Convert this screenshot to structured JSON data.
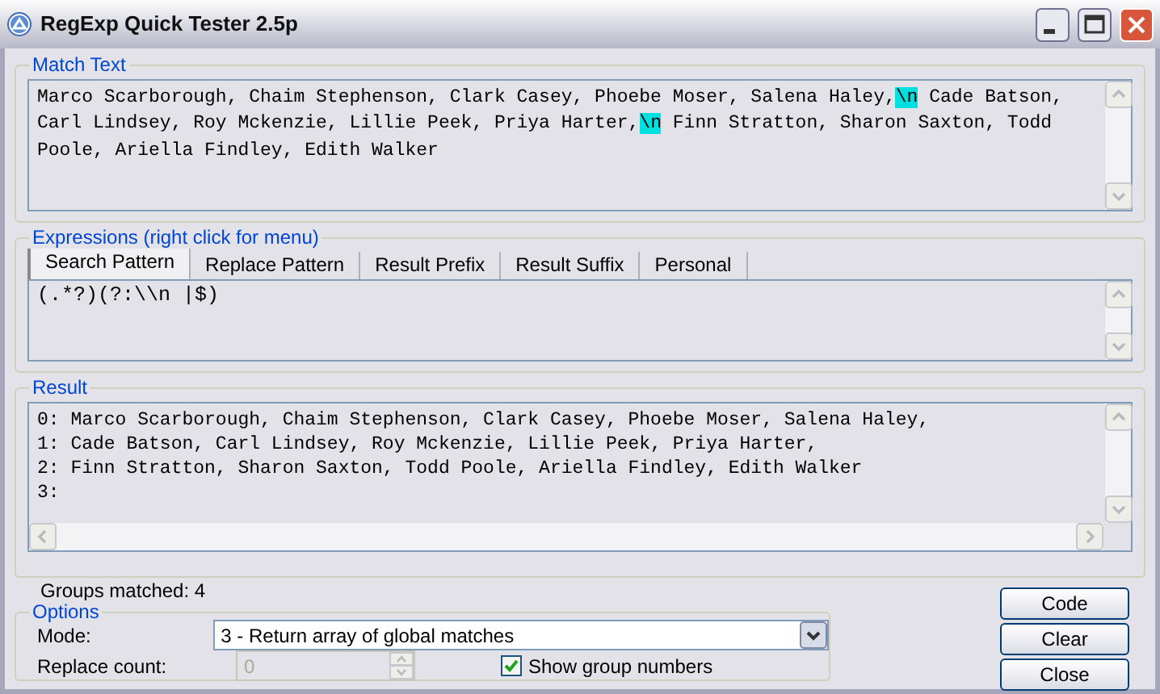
{
  "window": {
    "title": "RegExp Quick Tester 2.5p"
  },
  "match_text": {
    "label": "Match Text",
    "segments": [
      {
        "text": "Marco Scarborough, Chaim Stephenson, Clark Casey, Phoebe Moser, Salena Haley,",
        "highlighted": false
      },
      {
        "text": "\\n",
        "highlighted": true
      },
      {
        "text": " Cade Batson, Carl Lindsey, Roy Mckenzie, Lillie Peek, Priya Harter,",
        "highlighted": false
      },
      {
        "text": "\\n",
        "highlighted": true
      },
      {
        "text": " Finn Stratton, Sharon Saxton, Todd Poole, Ariella Findley, Edith Walker",
        "highlighted": false
      }
    ]
  },
  "expressions": {
    "label": "Expressions (right click for menu)",
    "tabs": [
      {
        "label": "Search Pattern",
        "selected": true
      },
      {
        "label": "Replace Pattern",
        "selected": false
      },
      {
        "label": "Result Prefix",
        "selected": false
      },
      {
        "label": "Result Suffix",
        "selected": false
      },
      {
        "label": "Personal",
        "selected": false
      }
    ],
    "pattern": "(.*?)(?:\\\\n |$)"
  },
  "result": {
    "label": "Result",
    "lines": [
      "0: Marco Scarborough, Chaim Stephenson, Clark Casey, Phoebe Moser, Salena Haley,",
      "1: Cade Batson, Carl Lindsey, Roy Mckenzie, Lillie Peek, Priya Harter,",
      "2: Finn Stratton, Sharon Saxton, Todd Poole, Ariella Findley, Edith Walker",
      "3:"
    ]
  },
  "groups_matched": "Groups matched: 4",
  "options": {
    "label": "Options",
    "mode_label": "Mode:",
    "mode_value": "3 - Return array of global matches",
    "replace_count_label": "Replace count:",
    "replace_count_value": "0",
    "replace_count_disabled": true,
    "show_group_numbers": {
      "label": "Show group numbers",
      "checked": true
    }
  },
  "buttons": [
    "Code",
    "Clear",
    "Close"
  ]
}
